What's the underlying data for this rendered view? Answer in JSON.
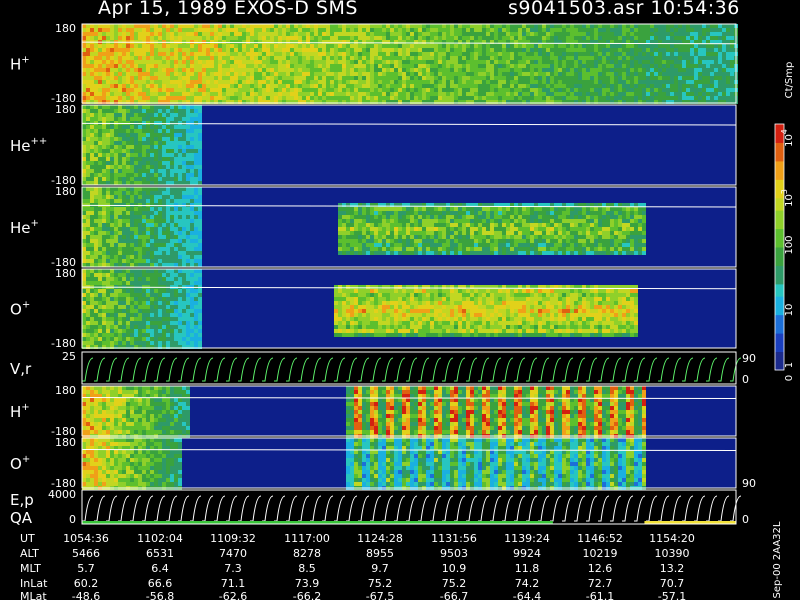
{
  "header": {
    "title": "Apr 15, 1989    EXOS-D SMS",
    "file_time": "s9041503.asr   10:54:36"
  },
  "colorbar": {
    "label": "Ct/Smp",
    "ticks": [
      {
        "value": 10000,
        "label": "10",
        "sup": "4"
      },
      {
        "value": 1000,
        "label": "10",
        "sup": "3"
      },
      {
        "value": 100,
        "label": "100",
        "sup": ""
      },
      {
        "value": 10,
        "label": "10",
        "sup": ""
      },
      {
        "value": 1,
        "label": "1",
        "sup": ""
      },
      {
        "value": 0,
        "label": "0",
        "sup": ""
      }
    ]
  },
  "side_note": "Sep-00 2AA32L",
  "footer": {
    "row_labels": [
      "UT",
      "ALT",
      "MLT",
      "InLat",
      "MLat"
    ],
    "columns": [
      {
        "UT": "1054:36",
        "ALT": "5466",
        "MLT": "5.7",
        "InLat": "60.2",
        "MLat": "-48.6"
      },
      {
        "UT": "1102:04",
        "ALT": "6531",
        "MLT": "6.4",
        "InLat": "66.6",
        "MLat": "-56.8"
      },
      {
        "UT": "1109:32",
        "ALT": "7470",
        "MLT": "7.3",
        "InLat": "71.1",
        "MLat": "-62.6"
      },
      {
        "UT": "1117:00",
        "ALT": "8278",
        "MLT": "8.5",
        "InLat": "73.9",
        "MLat": "-66.2"
      },
      {
        "UT": "1124:28",
        "ALT": "8955",
        "MLT": "9.7",
        "InLat": "75.2",
        "MLat": "-67.5"
      },
      {
        "UT": "1131:56",
        "ALT": "9503",
        "MLT": "10.9",
        "InLat": "75.2",
        "MLat": "-66.7"
      },
      {
        "UT": "1139:24",
        "ALT": "9924",
        "MLT": "11.8",
        "InLat": "74.2",
        "MLat": "-64.4"
      },
      {
        "UT": "1146:52",
        "ALT": "10219",
        "MLT": "12.6",
        "InLat": "72.7",
        "MLat": "-61.1"
      },
      {
        "UT": "1154:20",
        "ALT": "10390",
        "MLT": "13.2",
        "InLat": "70.7",
        "MLat": "-57.1"
      }
    ]
  },
  "chart_data": {
    "type": "heatmap",
    "x_range": [
      "1054:36",
      "1154:20"
    ],
    "colorscale": "log",
    "colorbar_label": "Ct/Smp",
    "colorbar_range": [
      0,
      10000
    ],
    "panels": [
      {
        "name": "H",
        "sup": "+",
        "ytop": "180",
        "ybot": "-180",
        "right": "",
        "kind": "spectro",
        "features": [
          {
            "t0": 0.0,
            "t1": 1.0,
            "level": "high",
            "band": "full"
          }
        ]
      },
      {
        "name": "He",
        "sup": "++",
        "ytop": "180",
        "ybot": "-180",
        "right": "",
        "kind": "spectro",
        "features": [
          {
            "t0": 0.0,
            "t1": 0.18,
            "level": "medium",
            "band": "full"
          }
        ]
      },
      {
        "name": "He",
        "sup": "+",
        "ytop": "180",
        "ybot": "-180",
        "right": "",
        "kind": "spectro",
        "features": [
          {
            "t0": 0.0,
            "t1": 0.18,
            "level": "medium",
            "band": "full"
          },
          {
            "t0": 0.39,
            "t1": 0.86,
            "level": "medium",
            "band": "center"
          }
        ]
      },
      {
        "name": "O",
        "sup": "+",
        "ytop": "180",
        "ybot": "-180",
        "right": "",
        "kind": "spectro",
        "features": [
          {
            "t0": 0.0,
            "t1": 0.18,
            "level": "medium",
            "band": "full"
          },
          {
            "t0": 0.38,
            "t1": 0.85,
            "level": "high",
            "band": "center"
          }
        ]
      },
      {
        "name": "V,r",
        "sup": "",
        "ytop": "25",
        "ybot": "",
        "right_top": "90",
        "right_bot": "0",
        "kind": "line"
      },
      {
        "name": "H",
        "sup": "+",
        "ytop": "180",
        "ybot": "-180",
        "right": "",
        "kind": "spectro",
        "features": [
          {
            "t0": 0.0,
            "t1": 0.16,
            "level": "high",
            "band": "full"
          },
          {
            "t0": 0.4,
            "t1": 0.86,
            "level": "high",
            "band": "striped"
          }
        ]
      },
      {
        "name": "O",
        "sup": "+",
        "ytop": "180",
        "ybot": "-180",
        "right_bot": "90",
        "kind": "spectro",
        "features": [
          {
            "t0": 0.0,
            "t1": 0.15,
            "level": "high",
            "band": "full"
          },
          {
            "t0": 0.4,
            "t1": 0.86,
            "level": "low",
            "band": "striped"
          }
        ]
      },
      {
        "name": "E,p",
        "sup": "",
        "name2": "QA",
        "ytop": "4000",
        "ybot": "0",
        "right_bot": "0",
        "kind": "line"
      }
    ]
  }
}
